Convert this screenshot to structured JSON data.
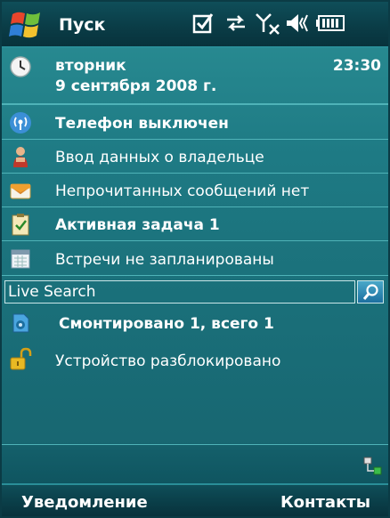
{
  "titlebar": {
    "start_label": "Пуск",
    "icons": [
      "windows-start-icon",
      "tasks-check-icon",
      "connectivity-icon",
      "signal-off-icon",
      "volume-icon",
      "battery-icon"
    ]
  },
  "today": {
    "weekday": "вторник",
    "date": "9 сентября 2008 г.",
    "time": "23:30",
    "phone_status": "Телефон выключен",
    "owner_info": "Ввод данных о владельце",
    "messages": "Непрочитанных сообщений нет",
    "tasks": "Активная задача 1",
    "appointments": "Встречи не запланированы",
    "mounted": "Смонтировано 1, всего 1",
    "lock_status": "Устройство разблокировано"
  },
  "search": {
    "value": "Live Search"
  },
  "softkeys": {
    "left": "Уведомление",
    "right": "Контакты"
  }
}
